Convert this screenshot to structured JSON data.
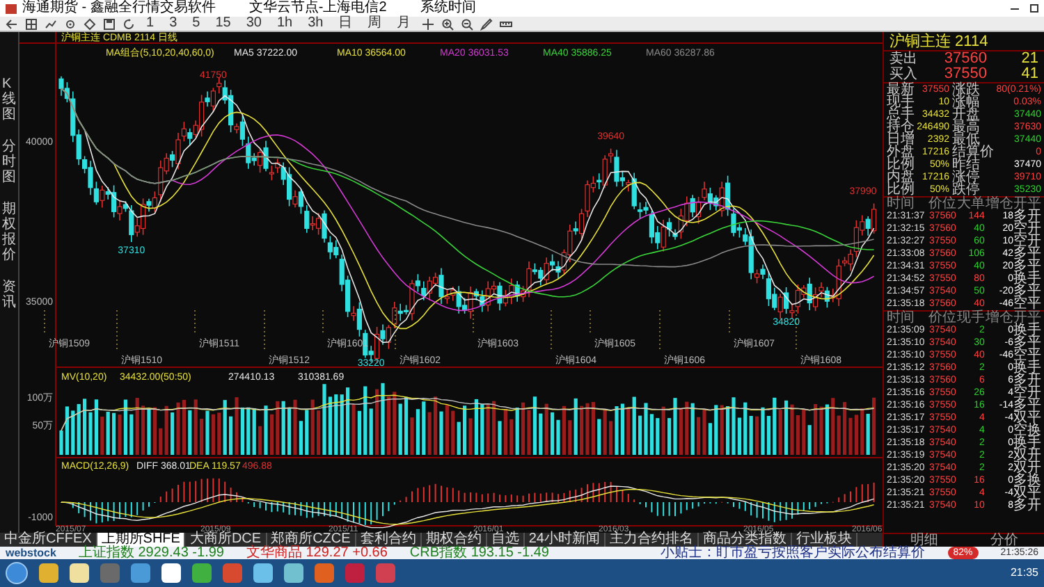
{
  "window": {
    "title": "海通期货 - 鑫融全行情交易软件",
    "tabs": [
      "文华云节点-上海电信2",
      "系统时间"
    ]
  },
  "toolbar": {
    "periods": [
      "1",
      "3",
      "5",
      "15",
      "30",
      "1h",
      "3h",
      "日",
      "周",
      "月"
    ]
  },
  "side_tabs": [
    "K线图",
    "分时图",
    "期权报价",
    "资讯"
  ],
  "chart": {
    "title": "沪铜主连 CDMB 2114 日线",
    "ma_label": "MA组合(5,10,20,40,60,0)",
    "ma": [
      {
        "name": "MA5",
        "value": "37222.00",
        "color": "#e8e8e8"
      },
      {
        "name": "MA10",
        "value": "36564.00",
        "color": "#e8e23a"
      },
      {
        "name": "MA20",
        "value": "36031.53",
        "color": "#d63ad6"
      },
      {
        "name": "MA40",
        "value": "35886.25",
        "color": "#3ad63a"
      },
      {
        "name": "MA60",
        "value": "36287.86",
        "color": "#8a8a8a"
      }
    ],
    "price_ticks": [
      "40000",
      "35000"
    ],
    "annotations": [
      {
        "label": "37310",
        "kind": "low"
      },
      {
        "label": "41750",
        "kind": "high"
      },
      {
        "label": "33220",
        "kind": "low"
      },
      {
        "label": "39640",
        "kind": "high"
      },
      {
        "label": "34820",
        "kind": "low"
      },
      {
        "label": "37990",
        "kind": "high"
      }
    ],
    "contracts": [
      "沪铜1509",
      "沪铜1510",
      "沪铜1511",
      "沪铜1512",
      "沪铜1601",
      "沪铜1602",
      "沪铜1603",
      "沪铜1604",
      "沪铜1605",
      "沪铜1606",
      "沪铜1607",
      "沪铜1608"
    ],
    "volume": {
      "label": "MV(10,20)",
      "values": [
        "34432.00(50:50)",
        "274410.13",
        "310381.69"
      ],
      "ticks": [
        "100万",
        "50万"
      ]
    },
    "macd": {
      "label": "MACD(12,26,9)",
      "diff_label": "DIFF",
      "diff": "368.01",
      "dea_label": "DEA",
      "dea": "119.57",
      "macd": "496.88",
      "ticks": [
        "-1000"
      ]
    },
    "dates": [
      "2015/07",
      "2015/09",
      "2015/11",
      "2016/01",
      "2016/03",
      "2016/05",
      "2016/06"
    ]
  },
  "bottom_tabs": [
    {
      "label": "中金所CFFEX",
      "selected": false
    },
    {
      "label": "上期所SHFE",
      "selected": true
    },
    {
      "label": "大商所DCE",
      "selected": false
    },
    {
      "label": "郑商所CZCE",
      "selected": false
    },
    {
      "label": "套利合约",
      "selected": false
    },
    {
      "label": "期权合约",
      "selected": false
    },
    {
      "label": "自选",
      "selected": false
    },
    {
      "label": "24小时新闻",
      "selected": false
    },
    {
      "label": "主力合约排名",
      "selected": false
    },
    {
      "label": "商品分类指数",
      "selected": false
    },
    {
      "label": "行业板块",
      "selected": false
    }
  ],
  "quote": {
    "title": "沪铜主连 2114",
    "sell": {
      "label": "卖出",
      "price": "37560",
      "volume": "21"
    },
    "buy": {
      "label": "买入",
      "price": "37550",
      "volume": "41"
    },
    "stats": [
      {
        "label": "最新",
        "value": "37550",
        "color": "#ff4040"
      },
      {
        "label": "涨跌",
        "value": "80(0.21%)",
        "color": "#ff4040"
      },
      {
        "label": "现手",
        "value": "10",
        "color": "#e8e23a"
      },
      {
        "label": "涨幅",
        "value": "0.03%",
        "color": "#ff4040"
      },
      {
        "label": "总手",
        "value": "34432",
        "color": "#e8e23a"
      },
      {
        "label": "开盘",
        "value": "37440",
        "color": "#30d030"
      },
      {
        "label": "持仓",
        "value": "246490",
        "color": "#e8e23a"
      },
      {
        "label": "最高",
        "value": "37630",
        "color": "#ff4040"
      },
      {
        "label": "日增",
        "value": "2392",
        "color": "#e8e23a"
      },
      {
        "label": "最低",
        "value": "37440",
        "color": "#30d030"
      },
      {
        "label": "外盘",
        "value": "17216",
        "color": "#e8e23a"
      },
      {
        "label": "结算价",
        "value": "0",
        "color": "#ff4040"
      },
      {
        "label": "比例",
        "value": "50%",
        "color": "#e8e23a"
      },
      {
        "label": "昨结",
        "value": "37470",
        "color": "#ffffff"
      },
      {
        "label": "内盘",
        "value": "17216",
        "color": "#e8e23a"
      },
      {
        "label": "涨停",
        "value": "39710",
        "color": "#ff4040"
      },
      {
        "label": "比例",
        "value": "50%",
        "color": "#e8e23a"
      },
      {
        "label": "跌停",
        "value": "35230",
        "color": "#30d030"
      }
    ],
    "big_trades": {
      "columns": [
        "时间",
        "价位",
        "大单",
        "增仓",
        "开平"
      ],
      "rows": [
        {
          "time": "21:31:37",
          "price": "37560",
          "volume": "144",
          "change": "18",
          "action": "多开",
          "up": true
        },
        {
          "time": "21:32:15",
          "price": "37560",
          "volume": "40",
          "change": "20",
          "action": "空开",
          "up": false
        },
        {
          "time": "21:32:27",
          "price": "37550",
          "volume": "60",
          "change": "10",
          "action": "空开",
          "up": false
        },
        {
          "time": "21:33:08",
          "price": "37560",
          "volume": "106",
          "change": "42",
          "action": "多平",
          "up": false
        },
        {
          "time": "21:34:31",
          "price": "37550",
          "volume": "40",
          "change": "20",
          "action": "多平",
          "up": false
        },
        {
          "time": "21:34:52",
          "price": "37550",
          "volume": "80",
          "change": "0",
          "action": "换手",
          "up": true
        },
        {
          "time": "21:34:57",
          "price": "37540",
          "volume": "50",
          "change": "-20",
          "action": "多平",
          "up": false
        },
        {
          "time": "21:35:18",
          "price": "37560",
          "volume": "40",
          "change": "-46",
          "action": "空平",
          "up": true
        }
      ]
    },
    "ticks": {
      "columns": [
        "时间",
        "价位",
        "现手",
        "增仓",
        "开平"
      ],
      "rows": [
        {
          "time": "21:35:09",
          "price": "37540",
          "volume": "2",
          "change": "0",
          "action": "换手",
          "up": false
        },
        {
          "time": "21:35:10",
          "price": "37540",
          "volume": "30",
          "change": "-6",
          "action": "多平",
          "up": false
        },
        {
          "time": "21:35:10",
          "price": "37550",
          "volume": "40",
          "change": "-46",
          "action": "空平",
          "up": true
        },
        {
          "time": "21:35:12",
          "price": "37560",
          "volume": "2",
          "change": "0",
          "action": "换手",
          "up": false
        },
        {
          "time": "21:35:13",
          "price": "37560",
          "volume": "6",
          "change": "6",
          "action": "多开",
          "up": true
        },
        {
          "time": "21:35:16",
          "price": "37550",
          "volume": "26",
          "change": "4",
          "action": "空开",
          "up": false
        },
        {
          "time": "21:35:16",
          "price": "37550",
          "volume": "16",
          "change": "-14",
          "action": "多平",
          "up": false
        },
        {
          "time": "21:35:17",
          "price": "37550",
          "volume": "4",
          "change": "-4",
          "action": "双平",
          "up": true
        },
        {
          "time": "21:35:17",
          "price": "37540",
          "volume": "4",
          "change": "0",
          "action": "空换",
          "up": false
        },
        {
          "time": "21:35:18",
          "price": "37540",
          "volume": "2",
          "change": "0",
          "action": "换手",
          "up": false
        },
        {
          "time": "21:35:19",
          "price": "37540",
          "volume": "2",
          "change": "2",
          "action": "双开",
          "up": false
        },
        {
          "time": "21:35:20",
          "price": "37540",
          "volume": "2",
          "change": "2",
          "action": "双开",
          "up": false
        },
        {
          "time": "21:35:20",
          "price": "37550",
          "volume": "16",
          "change": "0",
          "action": "多换",
          "up": true
        },
        {
          "time": "21:35:21",
          "price": "37550",
          "volume": "4",
          "change": "-4",
          "action": "双平",
          "up": true
        },
        {
          "time": "21:35:21",
          "price": "37540",
          "volume": "10",
          "change": "8",
          "action": "多开",
          "up": true
        }
      ]
    },
    "panel_tabs": [
      "明细",
      "分价"
    ]
  },
  "status_bar": {
    "brand": "webstock",
    "indices": [
      {
        "name": "上证指数",
        "value": "2929.43",
        "change": "-1.99",
        "up": false
      },
      {
        "name": "文华商品",
        "value": "129.27",
        "change": "+0.66",
        "up": true
      },
      {
        "name": "CRB指数",
        "value": "193.15",
        "change": "-1.49",
        "up": false
      }
    ],
    "tip": "小贴士：盯市盈亏按照客户实际公布结算价",
    "gauge": "82%",
    "time": "21:35:26"
  },
  "taskbar": {
    "clock": "21:35"
  }
}
